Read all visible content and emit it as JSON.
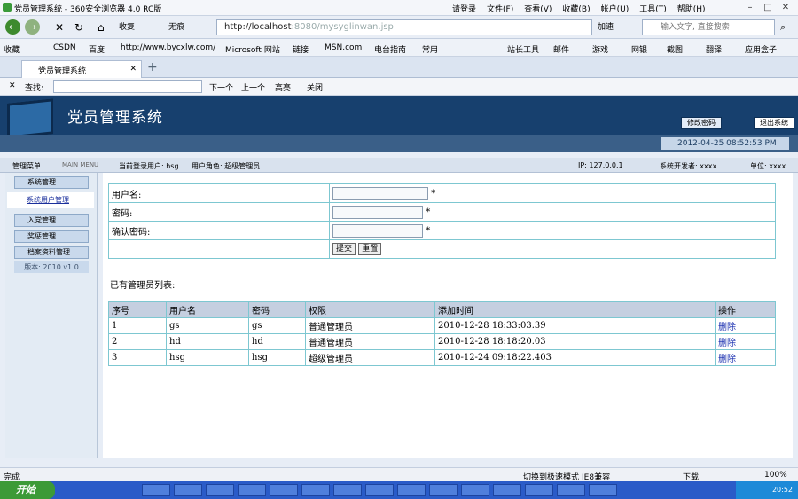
{
  "window": {
    "title": "党员管理系统 - 360安全浏览器 4.0 RC版",
    "menu": [
      "请登录",
      "文件(F)",
      "查看(V)",
      "收藏(B)",
      "帐户(U)",
      "工具(T)",
      "帮助(H)"
    ]
  },
  "nav": {
    "back": "←",
    "forward": "→",
    "stop": "✕",
    "refresh": "↻",
    "home": "⌂",
    "favorites": "收复",
    "clean": "无痕",
    "address_host": "http://localhost",
    "address_rest": ":8080/mysyglinwan.jsp",
    "accelerate": "加速",
    "search_placeholder": "输入文字, 直接搜索"
  },
  "bookmarks": {
    "left": [
      "收藏",
      "CSDN",
      "百度",
      "http://www.bycxlw.com/",
      "Microsoft 网站",
      "链接",
      "MSN.com",
      "电台指南",
      "常用"
    ],
    "right": [
      "站长工具",
      "邮件",
      "游戏",
      "网银",
      "截图",
      "翻译",
      "应用盒子"
    ]
  },
  "tabs": {
    "active": "党员管理系统",
    "new": "+"
  },
  "find": {
    "label": "查找:",
    "next": "下一个",
    "prev": "上一个",
    "highlight": "高亮",
    "close": "关闭"
  },
  "app": {
    "title": "党员管理系统",
    "modify_password": "修改密码",
    "logout": "退出系统",
    "datetime": "2012-04-25 08:52:53 PM"
  },
  "info": {
    "menu_label": "管理菜单",
    "menu_sub": "MAIN MENU",
    "current_user": "当前登录用户: hsg",
    "user_role": "用户角色: 超级管理员",
    "ip": "IP: 127.0.0.1",
    "developer": "系统开发者: xxxx",
    "unit": "单位: xxxx"
  },
  "sidebar": {
    "items": [
      "系统管理",
      "系统用户管理",
      "入党管理",
      "奖惩管理",
      "档案资料管理"
    ],
    "version": "版本: 2010 v1.0"
  },
  "form": {
    "username_label": "用户名:",
    "password_label": "密码:",
    "confirm_label": "确认密码:",
    "required": "*",
    "submit": "提交",
    "reset": "重置"
  },
  "list": {
    "title": "已有管理员列表:",
    "headers": [
      "序号",
      "用户名",
      "密码",
      "权限",
      "添加时间",
      "操作"
    ],
    "rows": [
      [
        "1",
        "gs",
        "gs",
        "普通管理员",
        "2010-12-28 18:33:03.39",
        "删除"
      ],
      [
        "2",
        "hd",
        "hd",
        "普通管理员",
        "2010-12-28 18:18:20.03",
        "删除"
      ],
      [
        "3",
        "hsg",
        "hsg",
        "超级管理员",
        "2010-12-24 09:18:22.403",
        "删除"
      ]
    ]
  },
  "status": {
    "left": "完成",
    "mode": "切换到极速模式",
    "ie": "IE8兼容",
    "download": "下载",
    "zoom": "100%"
  },
  "taskbar": {
    "start": "开始",
    "clock": "20:52"
  }
}
